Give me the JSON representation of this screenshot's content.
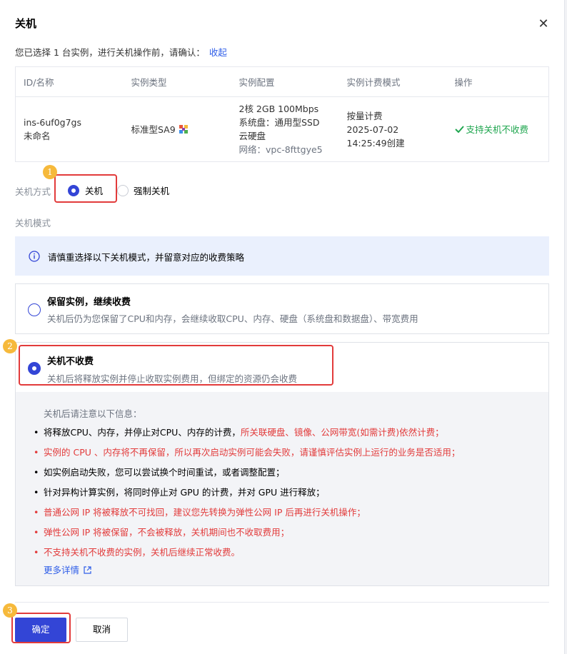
{
  "dialog": {
    "title": "关机",
    "intro": "您已选择 1 台实例，进行关机操作前，请确认：",
    "collapse_link": "收起"
  },
  "table": {
    "headers": [
      "ID/名称",
      "实例类型",
      "实例配置",
      "实例计费模式",
      "操作"
    ],
    "row": {
      "id": "ins-6uf0g7gs",
      "name": "未命名",
      "type": "标准型SA9",
      "config_line1": "2核 2GB 100Mbps",
      "config_line2": "系统盘：通用型SSD",
      "config_line3": "云硬盘",
      "config_line4": "网络：vpc-8fttgye5",
      "billing_line1": "按量计费",
      "billing_line2": "2025-07-02",
      "billing_line3": "14:25:49创建",
      "status": "支持关机不收费"
    }
  },
  "shutdown_method": {
    "label": "关机方式",
    "options": [
      "关机",
      "强制关机"
    ],
    "selected": "关机"
  },
  "shutdown_mode": {
    "label": "关机模式",
    "info": "请慎重选择以下关机模式，并留意对应的收费策略",
    "keep": {
      "title": "保留实例，继续收费",
      "desc": "关机后仍为您保留了CPU和内存，会继续收取CPU、内存、硬盘（系统盘和数据盘）、带宽费用"
    },
    "stop": {
      "title": "关机不收费",
      "desc": "关机后将释放实例并停止收取实例费用，但绑定的资源仍会收费"
    },
    "selected": "关机不收费"
  },
  "notes": {
    "head": "关机后请注意以下信息：",
    "items": [
      {
        "text": "将释放CPU、内存，并停止对CPU、内存的计费，",
        "red": "所关联硬盘、镜像、公网带宽(如需计费)依然计费；"
      },
      {
        "text": "实例的 CPU 、内存将不再保留，所以再次启动实例可能会失败，请谨慎评估实例上运行的业务是否适用；"
      },
      {
        "text": "如实例启动失败，您可以尝试换个时间重试，或者调整配置；"
      },
      {
        "text": "针对异构计算实例，将同时停止对 GPU 的计费，并对 GPU 进行释放；"
      },
      {
        "text": "普通公网 IP 将被释放不可找回，建议您先转换为弹性公网 IP 后再进行关机操作；"
      },
      {
        "text": "弹性公网 IP 将被保留，不会被释放，关机期间也不收取费用；"
      },
      {
        "text": "不支持关机不收费的实例，关机后继续正常收费。"
      }
    ],
    "more": "更多详情"
  },
  "callouts": [
    "1",
    "2",
    "3"
  ],
  "buttons": {
    "confirm": "确定",
    "cancel": "取消"
  },
  "colors": {
    "primary": "#3345d6",
    "link": "#2f5ee8",
    "success": "#1fa64f",
    "danger": "#e23b3b",
    "callout": "#f6b93b"
  }
}
